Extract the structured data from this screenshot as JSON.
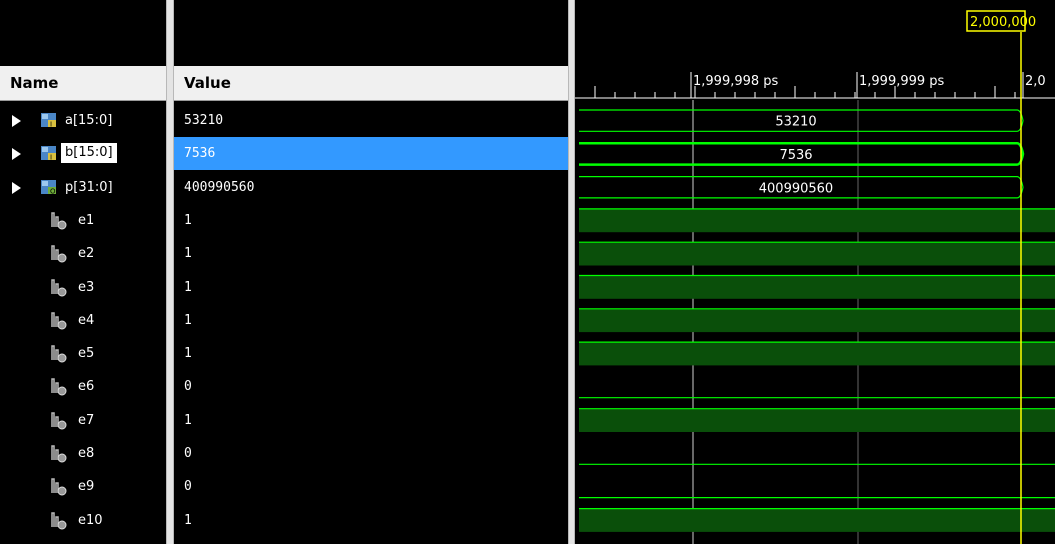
{
  "headers": {
    "name": "Name",
    "value": "Value"
  },
  "timeline": {
    "cursor_label": "2,000,000",
    "ticks": [
      "1,999,998 ps",
      "1,999,999 ps",
      "2,0"
    ]
  },
  "signals": [
    {
      "name": "a[15:0]",
      "value": "53210",
      "kind": "bus",
      "bus_tag": "I",
      "expandable": true,
      "selected": false
    },
    {
      "name": "b[15:0]",
      "value": "7536",
      "kind": "bus",
      "bus_tag": "I",
      "expandable": true,
      "selected": true
    },
    {
      "name": "p[31:0]",
      "value": "400990560",
      "kind": "bus",
      "bus_tag": "O",
      "expandable": true,
      "selected": false
    },
    {
      "name": "e1",
      "value": "1",
      "kind": "bit"
    },
    {
      "name": "e2",
      "value": "1",
      "kind": "bit"
    },
    {
      "name": "e3",
      "value": "1",
      "kind": "bit"
    },
    {
      "name": "e4",
      "value": "1",
      "kind": "bit"
    },
    {
      "name": "e5",
      "value": "1",
      "kind": "bit"
    },
    {
      "name": "e6",
      "value": "0",
      "kind": "bit"
    },
    {
      "name": "e7",
      "value": "1",
      "kind": "bit"
    },
    {
      "name": "e8",
      "value": "0",
      "kind": "bit"
    },
    {
      "name": "e9",
      "value": "0",
      "kind": "bit"
    },
    {
      "name": "e10",
      "value": "1",
      "kind": "bit"
    }
  ],
  "colors": {
    "wave_green": "#00ff00",
    "wave_high_fill": "#0a4f0a",
    "cursor_yellow": "#ffff00",
    "selection": "#3399ff"
  }
}
